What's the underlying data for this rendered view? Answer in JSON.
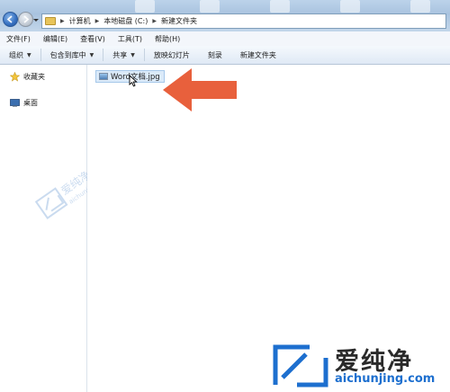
{
  "address": {
    "crumbs": [
      "计算机",
      "本地磁盘 (C:)",
      "新建文件夹"
    ]
  },
  "menu": [
    "文件(F)",
    "编辑(E)",
    "查看(V)",
    "工具(T)",
    "帮助(H)"
  ],
  "toolbar": {
    "organize": "组织",
    "include_in_library": "包含到库中",
    "share": "共享",
    "slideshow": "放映幻灯片",
    "burn": "刻录",
    "new_folder": "新建文件夹"
  },
  "nav": {
    "favorites": "收藏夹",
    "desktop": "桌面"
  },
  "files": [
    {
      "name": "Word文档.jpg"
    }
  ],
  "watermark": {
    "small_cn": "爱纯净",
    "small_url": "aichunjing.com",
    "big_cn": "爱纯净",
    "big_url": "aichunjing.com"
  },
  "colors": {
    "arrow": "#e8603c",
    "accent": "#1d6fcf"
  }
}
